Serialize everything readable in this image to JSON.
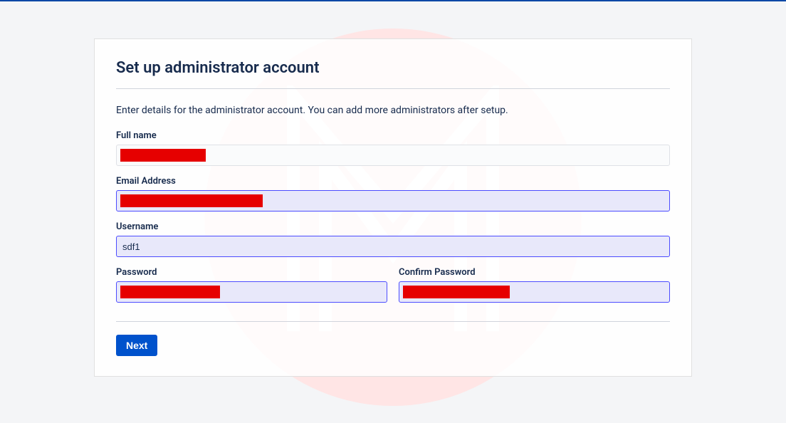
{
  "page": {
    "title": "Set up administrator account",
    "description": "Enter details for the administrator account. You can add more administrators after setup."
  },
  "form": {
    "fullname_label": "Full name",
    "fullname_value": "",
    "email_label": "Email Address",
    "email_value": "",
    "username_label": "Username",
    "username_value": "sdf1",
    "password_label": "Password",
    "password_value": "",
    "confirm_password_label": "Confirm Password",
    "confirm_password_value": ""
  },
  "buttons": {
    "next_label": "Next"
  }
}
